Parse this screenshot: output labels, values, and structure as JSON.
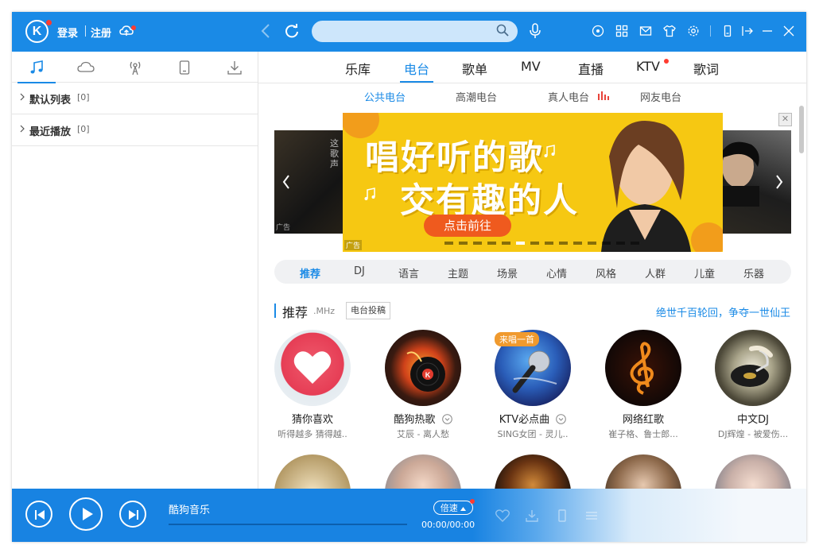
{
  "header": {
    "logo": "K",
    "login": "登录",
    "register": "注册",
    "search_placeholder": "",
    "colors": {
      "primary": "#1a8ae6",
      "alert": "#ff3b30"
    }
  },
  "sidebar": {
    "tabs": [
      "music-note-icon",
      "cloud-icon",
      "radio-icon",
      "device-icon",
      "download-icon"
    ],
    "lists": [
      {
        "name": "默认列表",
        "count": "[0]"
      },
      {
        "name": "最近播放",
        "count": "[0]"
      }
    ]
  },
  "topnav": {
    "tabs": [
      {
        "label": "乐库",
        "active": false
      },
      {
        "label": "电台",
        "active": true
      },
      {
        "label": "歌单",
        "active": false
      },
      {
        "label": "MV",
        "active": false
      },
      {
        "label": "直播",
        "active": false
      },
      {
        "label": "KTV",
        "active": false,
        "dot": true
      },
      {
        "label": "歌词",
        "active": false
      }
    ]
  },
  "subnav": {
    "tabs": [
      {
        "label": "公共电台",
        "active": true
      },
      {
        "label": "高潮电台",
        "active": false
      },
      {
        "label": "真人电台",
        "active": false
      },
      {
        "label": "网友电台",
        "active": false
      }
    ]
  },
  "banner": {
    "line1": "唱好听的歌",
    "line2": "交有趣的人",
    "button": "点击前往",
    "ad": "广告",
    "side_ad": "广告",
    "side_text": "这歌声",
    "close": "✕",
    "active_dot_fraction": 0.35
  },
  "categories": [
    "推荐",
    "DJ",
    "语言",
    "主题",
    "场景",
    "心情",
    "风格",
    "人群",
    "儿童",
    "乐器"
  ],
  "section": {
    "title": "推荐",
    "unit": ".MHz",
    "button": "电台投稿",
    "link": "绝世千百轮回，争夺一世仙王"
  },
  "cards": [
    {
      "title": "猜你喜欢",
      "subtitle": "听得越多 猜得越..",
      "badge": "",
      "dropdown": false
    },
    {
      "title": "酷狗热歌",
      "subtitle": "艾辰 - 离人愁",
      "badge": "",
      "dropdown": true
    },
    {
      "title": "KTV必点曲",
      "subtitle": "SING女团 - 灵儿..",
      "badge": "来唱一首",
      "dropdown": true
    },
    {
      "title": "网络红歌",
      "subtitle": "崔子格、鲁士郎...",
      "badge": "",
      "dropdown": false
    },
    {
      "title": "中文DJ",
      "subtitle": "DJ辉煌 - 被爱伤...",
      "badge": "",
      "dropdown": false
    }
  ],
  "player": {
    "title": "酷狗音乐",
    "speed": "倍速",
    "time": "00:00/00:00",
    "progress": 0
  }
}
